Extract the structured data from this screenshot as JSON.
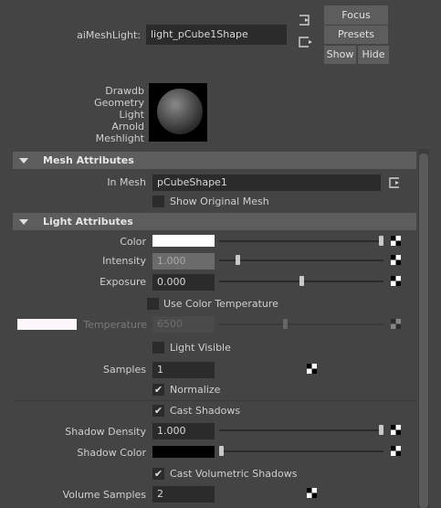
{
  "header": {
    "node_label": "aiMeshLight:",
    "node_value": "light_pCube1Shape",
    "focus": "Focus",
    "presets": "Presets",
    "show": "Show",
    "hide": "Hide"
  },
  "swatch": {
    "lines": [
      "Drawdb",
      "Geometry",
      "Light",
      "Arnold",
      "Meshlight"
    ]
  },
  "mesh_attrs": {
    "title": "Mesh Attributes",
    "in_mesh_label": "In Mesh",
    "in_mesh_value": "pCubeShape1",
    "show_original_label": "Show Original Mesh",
    "show_original_checked": false
  },
  "light_attrs": {
    "title": "Light Attributes",
    "color_label": "Color",
    "color_value": "#ffffff",
    "color_slider": 1.0,
    "intensity_label": "Intensity",
    "intensity_value": "1.000",
    "intensity_slider": 0.1,
    "exposure_label": "Exposure",
    "exposure_value": "0.000",
    "exposure_slider": 0.5,
    "use_color_temp_label": "Use Color Temperature",
    "use_color_temp_checked": false,
    "temperature_label": "Temperature",
    "temperature_value": "6500",
    "temperature_slider": 0.4,
    "temperature_swatch": "#fdf6fb",
    "light_visible_label": "Light Visible",
    "light_visible_checked": false,
    "samples_label": "Samples",
    "samples_value": "1",
    "normalize_label": "Normalize",
    "normalize_checked": true,
    "cast_shadows_label": "Cast Shadows",
    "cast_shadows_checked": true,
    "shadow_density_label": "Shadow Density",
    "shadow_density_value": "1.000",
    "shadow_density_slider": 1.0,
    "shadow_color_label": "Shadow Color",
    "shadow_color_value": "#000000",
    "shadow_color_slider": 0.0,
    "cast_vol_shadows_label": "Cast Volumetric Shadows",
    "cast_vol_shadows_checked": true,
    "volume_samples_label": "Volume Samples",
    "volume_samples_value": "2"
  },
  "icons": {
    "check": "✔",
    "map": "checker-map-icon",
    "connect": "connection-icon"
  }
}
